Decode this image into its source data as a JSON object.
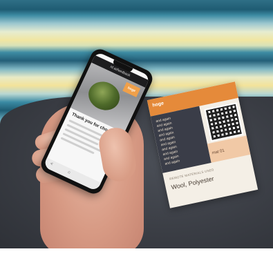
{
  "phone": {
    "url": "hf.ai/feedback",
    "badge": "hoge",
    "headline": "Thank you for choosing",
    "nav_back": "<",
    "nav_home": "⌂"
  },
  "card": {
    "brand": "hoge",
    "materials": [
      "and again",
      "and again",
      "and again",
      "and again",
      "and again",
      "and again",
      "and again",
      "and again",
      "and again",
      "and again"
    ],
    "peach_text": "mat 01",
    "bottom_label": "REMOTE MATERIALS USED",
    "bottom_value": "Wool, Polyester"
  },
  "colors": {
    "orange": "#e58a3a",
    "card_dark": "#3a3d48",
    "teal": "#2f6f86"
  }
}
